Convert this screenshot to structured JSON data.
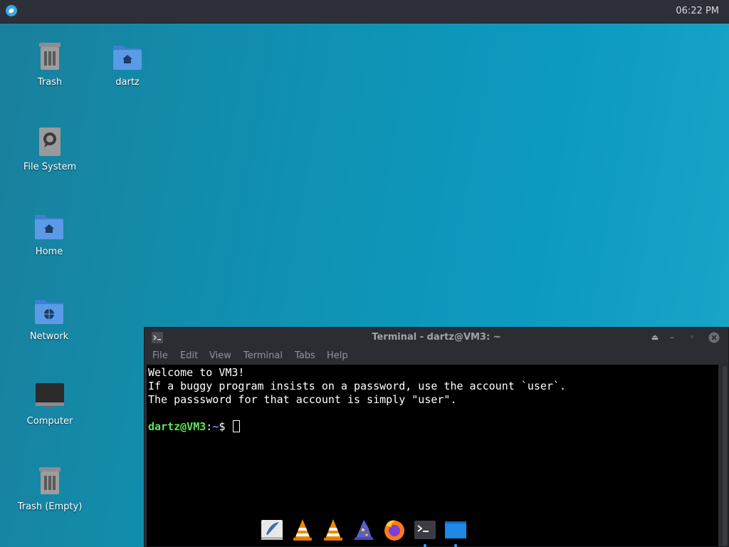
{
  "panel": {
    "clock": "06:22 PM"
  },
  "desktop": {
    "icons": [
      {
        "label": "Trash"
      },
      {
        "label": "dartz"
      },
      {
        "label": "File System"
      },
      {
        "label": "Home"
      },
      {
        "label": "Network"
      },
      {
        "label": "Computer"
      },
      {
        "label": "Trash (Empty)"
      }
    ]
  },
  "terminal": {
    "title": "Terminal - dartz@VM3: ~",
    "menu": [
      "File",
      "Edit",
      "View",
      "Terminal",
      "Tabs",
      "Help"
    ],
    "lines": [
      "Welcome to VM3!",
      "If a buggy program insists on a password, use the account `user`.",
      "The passsword for that account is simply \"user\"."
    ],
    "prompt_user": "dartz@VM3",
    "prompt_sep": ":",
    "prompt_path": "~",
    "prompt_symbol": "$"
  },
  "dock": {
    "items": [
      "text-editor-icon",
      "vlc-icon",
      "vlc-icon",
      "wizard-icon",
      "firefox-icon",
      "terminal-icon",
      "file-manager-icon"
    ]
  },
  "colors": {
    "accent": "#0f93b5",
    "panel": "#2d3038",
    "prompt_user": "#5ee55a",
    "prompt_path": "#6c8cff"
  }
}
